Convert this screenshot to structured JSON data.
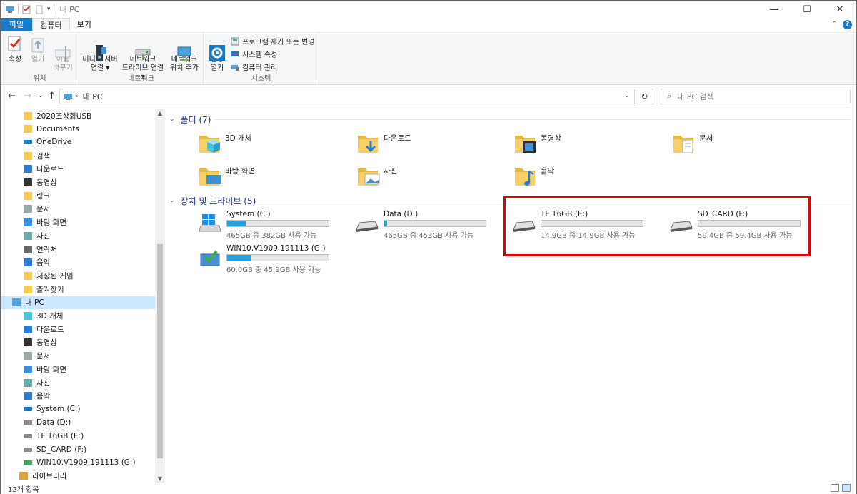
{
  "window": {
    "title": "내 PC",
    "controls": {
      "minimize": "—",
      "maximize": "☐",
      "close": "✕"
    }
  },
  "ribbon": {
    "tabs": [
      {
        "label": "파일"
      },
      {
        "label": "컴퓨터"
      },
      {
        "label": "보기"
      }
    ],
    "groups": {
      "location": {
        "label": "위치",
        "buttons": [
          {
            "label": "속성",
            "icon": "properties-check-icon"
          },
          {
            "label": "열기",
            "icon": "open-icon"
          },
          {
            "label": "이름\n바꾸기",
            "icon": "rename-icon"
          }
        ]
      },
      "network": {
        "label": "네트워크",
        "buttons": [
          {
            "label": "미디어 서버\n연결 ▾",
            "icon": "media-server-icon"
          },
          {
            "label": "네트워크\n드라이브 연결 ▾",
            "icon": "network-drive-icon"
          },
          {
            "label": "네트워크\n위치 추가",
            "icon": "network-location-icon"
          }
        ]
      },
      "system": {
        "label": "시스템",
        "open_settings": "설정\n열기",
        "items": [
          {
            "label": "프로그램 제거 또는 변경"
          },
          {
            "label": "시스템 속성"
          },
          {
            "label": "컴퓨터 관리"
          }
        ]
      }
    }
  },
  "address": {
    "crumb": "내 PC",
    "search_placeholder": "내 PC 검색"
  },
  "nav_pane": {
    "items": [
      {
        "label": "2020조상회USB",
        "icon": "folder-icon"
      },
      {
        "label": "Documents",
        "icon": "folder-icon"
      },
      {
        "label": "OneDrive",
        "icon": "onedrive-icon"
      },
      {
        "label": "검색",
        "icon": "search-folder-icon"
      },
      {
        "label": "다운로드",
        "icon": "download-icon"
      },
      {
        "label": "동영상",
        "icon": "video-icon"
      },
      {
        "label": "링크",
        "icon": "links-icon"
      },
      {
        "label": "문서",
        "icon": "document-icon"
      },
      {
        "label": "바탕 화면",
        "icon": "desktop-icon"
      },
      {
        "label": "사진",
        "icon": "pictures-icon"
      },
      {
        "label": "연락처",
        "icon": "contacts-icon"
      },
      {
        "label": "음악",
        "icon": "music-icon"
      },
      {
        "label": "저장된 게임",
        "icon": "saved-games-icon"
      },
      {
        "label": "즐겨찾기",
        "icon": "favorites-icon"
      },
      {
        "label": "내 PC",
        "icon": "this-pc-icon",
        "selected": true
      },
      {
        "label": "3D 개체",
        "icon": "3d-objects-icon"
      },
      {
        "label": "다운로드",
        "icon": "download-icon"
      },
      {
        "label": "동영상",
        "icon": "video-icon"
      },
      {
        "label": "문서",
        "icon": "document-icon"
      },
      {
        "label": "바탕 화면",
        "icon": "desktop-icon"
      },
      {
        "label": "사진",
        "icon": "pictures-icon"
      },
      {
        "label": "음악",
        "icon": "music-icon"
      },
      {
        "label": "System (C:)",
        "icon": "system-drive-icon"
      },
      {
        "label": "Data (D:)",
        "icon": "drive-icon"
      },
      {
        "label": "TF 16GB (E:)",
        "icon": "drive-icon"
      },
      {
        "label": "SD_CARD (F:)",
        "icon": "drive-icon"
      },
      {
        "label": "WIN10.V1909.191113 (G:)",
        "icon": "dvd-drive-icon"
      },
      {
        "label": "라이브러리",
        "icon": "library-icon"
      }
    ]
  },
  "content": {
    "folders_header": "폴더 (7)",
    "drives_header": "장치 및 드라이브 (5)",
    "folders": [
      {
        "name": "3D 개체",
        "icon": "3d-objects-folder-icon"
      },
      {
        "name": "다운로드",
        "icon": "downloads-folder-icon"
      },
      {
        "name": "동영상",
        "icon": "videos-folder-icon"
      },
      {
        "name": "문서",
        "icon": "documents-folder-icon"
      },
      {
        "name": "바탕 화면",
        "icon": "desktop-folder-icon"
      },
      {
        "name": "사진",
        "icon": "pictures-folder-icon"
      },
      {
        "name": "음악",
        "icon": "music-folder-icon"
      }
    ],
    "drives": [
      {
        "name": "System (C:)",
        "free": "465GB 중 382GB 사용 가능",
        "used_fraction": 0.18,
        "icon": "windows-drive-icon"
      },
      {
        "name": "Data (D:)",
        "free": "465GB 중 453GB 사용 가능",
        "used_fraction": 0.03,
        "icon": "hard-drive-icon"
      },
      {
        "name": "TF 16GB (E:)",
        "free": "14.9GB 중 14.9GB 사용 가능",
        "used_fraction": 0.0,
        "icon": "removable-drive-icon"
      },
      {
        "name": "SD_CARD (F:)",
        "free": "59.4GB 중 59.4GB 사용 가능",
        "used_fraction": 0.0,
        "icon": "removable-drive-icon"
      },
      {
        "name": "WIN10.V1909.191113 (G:)",
        "free": "60.0GB 중 45.9GB 사용 가능",
        "used_fraction": 0.24,
        "icon": "install-media-drive-icon"
      }
    ],
    "highlight_color": "#e00000"
  },
  "status": {
    "item_count": "12개 항목"
  },
  "colors": {
    "accent": "#1979ca",
    "bar_fill": "#26a0da",
    "selected_bg": "#cce8ff"
  }
}
